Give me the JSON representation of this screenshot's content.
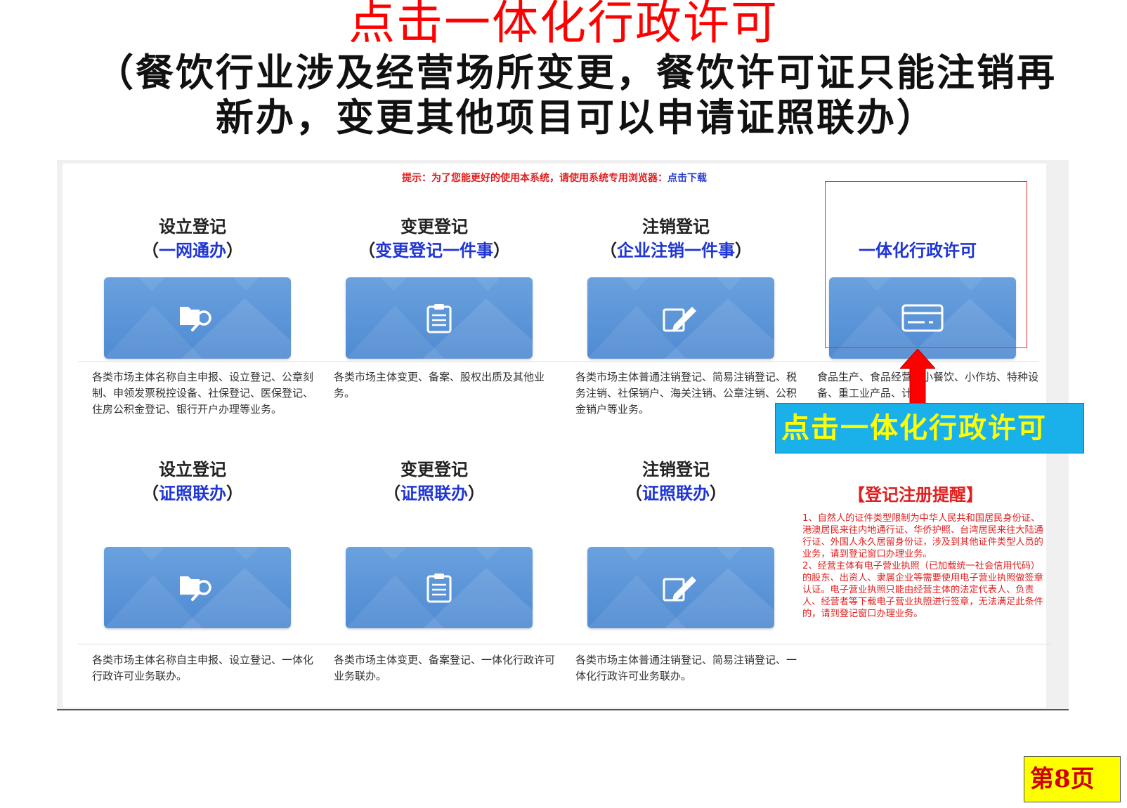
{
  "slide": {
    "title": "点击一体化行政许可",
    "subtitle": "（餐饮行业涉及经营场所变更，餐饮许可证只能注销再新办，变更其他项目可以申请证照联办）"
  },
  "tip": {
    "text": "提示：为了您能更好的使用本系统，请使用系统专用浏览器：",
    "link": "点击下载"
  },
  "cards": [
    {
      "title": "设立登记",
      "open": "（",
      "sub": "一网通办",
      "close": "）",
      "icon": "folder-search-icon",
      "desc": "各类市场主体名称自主申报、设立登记、公章刻制、申领发票税控设备、社保登记、医保登记、住房公积金登记、银行开户办理等业务。"
    },
    {
      "title": "变更登记",
      "open": "（",
      "sub": "变更登记一件事",
      "close": "）",
      "icon": "clipboard-icon",
      "desc": "各类市场主体变更、备案、股权出质及其他业务。"
    },
    {
      "title": "注销登记",
      "open": "（",
      "sub": "企业注销一件事",
      "close": "）",
      "icon": "edit-pen-icon",
      "desc": "各类市场主体普通注销登记、简易注销登记、税务注销、社保销户、海关注销、公章注销、公积金销户等业务。"
    },
    {
      "title": "一体化行政许可",
      "icon": "id-card-icon",
      "desc": "食品生产、食品经营、小餐饮、小作坊、特种设备、重工业产品、计"
    },
    {
      "title": "设立登记",
      "open": "（",
      "sub": "证照联办",
      "close": "）",
      "icon": "folder-search-icon",
      "desc": "各类市场主体名称自主申报、设立登记、一体化行政许可业务联办。"
    },
    {
      "title": "变更登记",
      "open": "（",
      "sub": "证照联办",
      "close": "）",
      "icon": "clipboard-icon",
      "desc": "各类市场主体变更、备案登记、一体化行政许可业务联办。"
    },
    {
      "title": "注销登记",
      "open": "（",
      "sub": "证照联办",
      "close": "）",
      "icon": "edit-pen-icon",
      "desc": "各类市场主体普通注销登记、简易注销登记、一体化行政许可业务联办。"
    }
  ],
  "reminder": {
    "title": "【登记注册提醒】",
    "items": [
      "1、自然人的证件类型限制为中华人民共和国居民身份证、港澳居民来往内地通行证、华侨护照、台湾居民来往大陆通行证、外国人永久居留身份证，涉及到其他证件类型人员的业务，请到登记窗口办理业务。",
      "2、经营主体有电子营业执照（已加载统一社会信用代码）的股东、出资人、隶属企业等需要使用电子营业执照做签章认证。电子营业执照只能由经营主体的法定代表人、负责人、经营者等下载电子营业执照进行签章，无法满足此条件的，请到登记窗口办理业务。"
    ]
  },
  "callout": {
    "label": "点击一体化行政许可"
  },
  "page": {
    "label": "第8页"
  },
  "colors": {
    "accent_red": "#ff0000",
    "link_blue": "#1f35d6",
    "tile_blue": "#5b95d8",
    "callout_bg": "#1ab0ea",
    "callout_text": "#ffff00",
    "badge_bg": "#ffff00"
  }
}
